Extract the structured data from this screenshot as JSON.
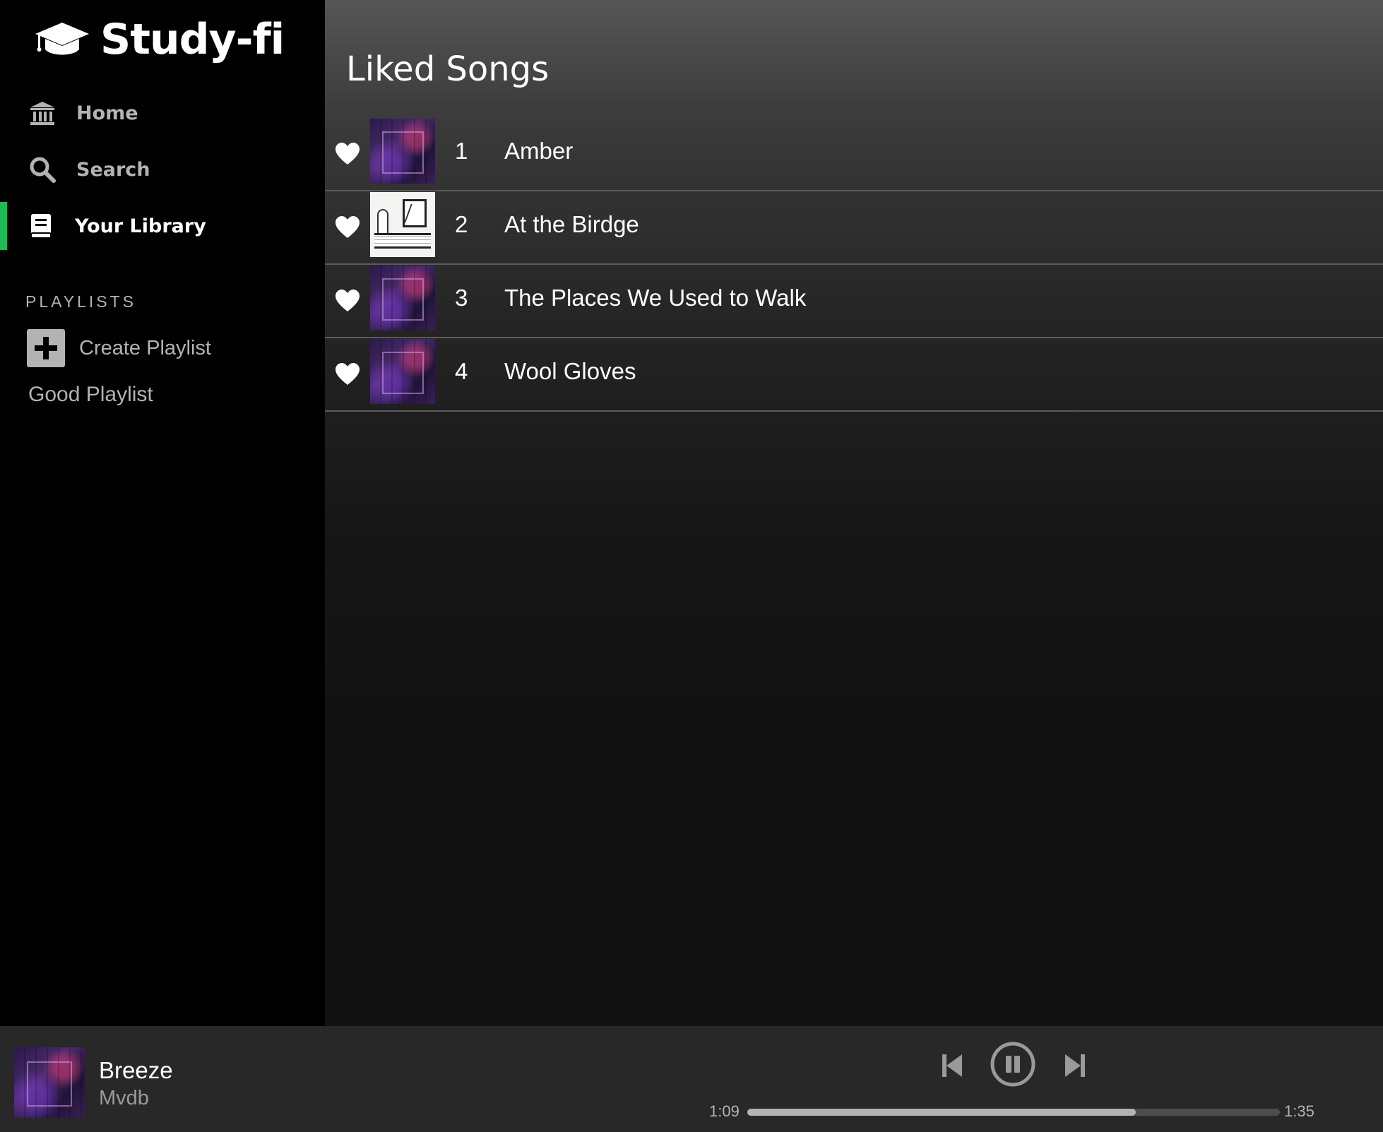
{
  "app": {
    "name": "Study-fi"
  },
  "sidebar": {
    "nav": [
      {
        "label": "Home",
        "icon": "bank-icon",
        "active": false
      },
      {
        "label": "Search",
        "icon": "search-icon",
        "active": false
      },
      {
        "label": "Your Library",
        "icon": "book-icon",
        "active": true
      }
    ],
    "playlists_heading": "PLAYLISTS",
    "create_playlist_label": "Create Playlist",
    "playlists": [
      "Good Playlist"
    ]
  },
  "main": {
    "title": "Liked Songs",
    "songs": [
      {
        "number": "1",
        "title": "Amber",
        "liked": true,
        "art": "dark-cityscape"
      },
      {
        "number": "2",
        "title": "At the Birdge",
        "liked": true,
        "art": "sketch-bedroom"
      },
      {
        "number": "3",
        "title": "The Places We Used to Walk",
        "liked": true,
        "art": "dark-cityscape"
      },
      {
        "number": "4",
        "title": "Wool Gloves",
        "liked": true,
        "art": "dark-cityscape"
      }
    ]
  },
  "player": {
    "track_title": "Breeze",
    "artist": "Mvdb",
    "current_time": "1:09",
    "total_time": "1:35",
    "progress_fraction": 0.73,
    "state": "playing"
  },
  "colors": {
    "accent": "#1db954",
    "sidebar_bg": "#000000",
    "player_bg": "#282828",
    "muted_text": "#b3b3b3"
  }
}
